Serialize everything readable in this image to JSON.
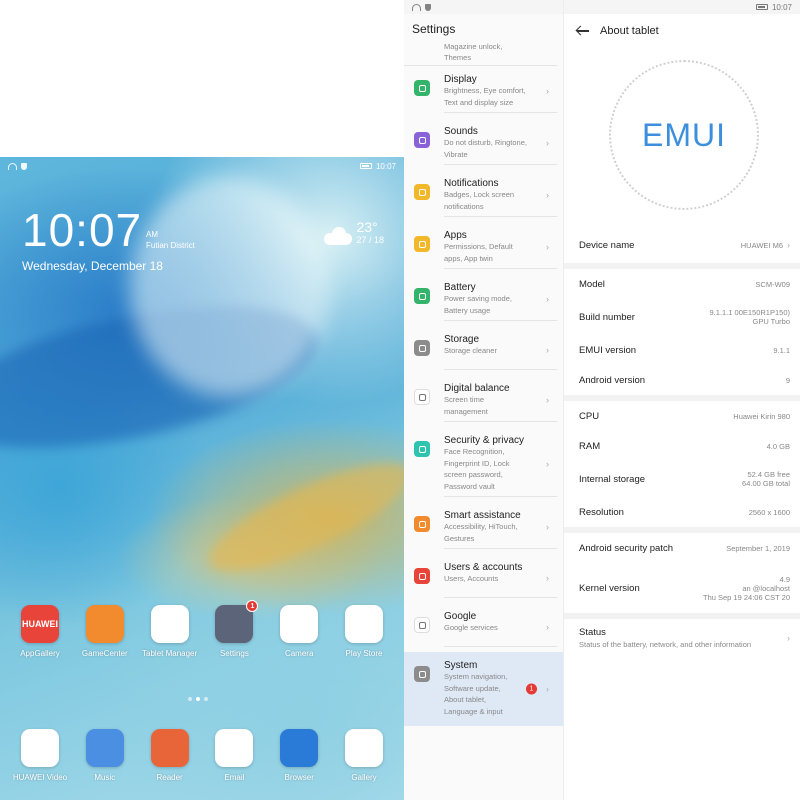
{
  "home": {
    "status_time": "10:07",
    "clock_time": "10:07",
    "ampm": "AM",
    "location": "Futian District",
    "date": "Wednesday, December 18",
    "weather": {
      "temp": "23°",
      "range": "27 / 18"
    },
    "apps_row1": [
      {
        "label": "AppGallery",
        "icon": "appgallery-icon",
        "color": "#e8443a",
        "text": "HUAWEI"
      },
      {
        "label": "GameCenter",
        "icon": "gamecenter-icon",
        "color": "#f28a2e",
        "text": ""
      },
      {
        "label": "Tablet Manager",
        "icon": "tablet-manager-icon",
        "color": "#ffffff",
        "text": ""
      },
      {
        "label": "Settings",
        "icon": "settings-icon",
        "color": "#5b6478",
        "text": "",
        "badge": "1"
      },
      {
        "label": "Camera",
        "icon": "camera-icon",
        "color": "#ffffff",
        "text": ""
      },
      {
        "label": "Play Store",
        "icon": "play-store-icon",
        "color": "#ffffff",
        "text": ""
      }
    ],
    "apps_dock": [
      {
        "label": "HUAWEI Video",
        "icon": "video-icon",
        "color": "#ffffff",
        "text": ""
      },
      {
        "label": "Music",
        "icon": "music-icon",
        "color": "#4b8fe3",
        "text": ""
      },
      {
        "label": "Reader",
        "icon": "reader-icon",
        "color": "#e8653a",
        "text": ""
      },
      {
        "label": "Email",
        "icon": "email-icon",
        "color": "#ffffff",
        "text": ""
      },
      {
        "label": "Browser",
        "icon": "browser-icon",
        "color": "#2a7ad8",
        "text": ""
      },
      {
        "label": "Gallery",
        "icon": "gallery-icon",
        "color": "#ffffff",
        "text": ""
      }
    ]
  },
  "settings": {
    "status_time": "10:07",
    "title": "Settings",
    "partial_top": [
      "Magazine unlock,",
      "Themes"
    ],
    "items": [
      {
        "title": "Display",
        "sub": [
          "Brightness, Eye comfort,",
          "Text and display size"
        ],
        "color": "#33b46a",
        "icon": "display-icon"
      },
      {
        "title": "Sounds",
        "sub": [
          "Do not disturb, Ringtone,",
          "Vibrate"
        ],
        "color": "#8a62d8",
        "icon": "sounds-icon"
      },
      {
        "title": "Notifications",
        "sub": [
          "Badges, Lock screen",
          "notifications"
        ],
        "color": "#f2b829",
        "icon": "notifications-icon"
      },
      {
        "title": "Apps",
        "sub": [
          "Permissions, Default",
          "apps, App twin"
        ],
        "color": "#f2b829",
        "icon": "apps-icon"
      },
      {
        "title": "Battery",
        "sub": [
          "Power saving mode,",
          "Battery usage"
        ],
        "color": "#33b46a",
        "icon": "battery-icon"
      },
      {
        "title": "Storage",
        "sub": [
          "Storage cleaner"
        ],
        "color": "#8c8c8c",
        "icon": "storage-icon"
      },
      {
        "title": "Digital balance",
        "sub": [
          "Screen time",
          "management"
        ],
        "color": "#ffffff",
        "icon": "digital-balance-icon"
      },
      {
        "title": "Security & privacy",
        "sub": [
          "Face Recognition,",
          "Fingerprint ID, Lock",
          "screen password,",
          "Password vault"
        ],
        "color": "#2ec4b0",
        "icon": "security-icon"
      },
      {
        "title": "Smart assistance",
        "sub": [
          "Accessibility, HiTouch,",
          "Gestures"
        ],
        "color": "#f28a2e",
        "icon": "smart-assistance-icon"
      },
      {
        "title": "Users & accounts",
        "sub": [
          "Users, Accounts"
        ],
        "color": "#e8443a",
        "icon": "users-icon"
      },
      {
        "title": "Google",
        "sub": [
          "Google services"
        ],
        "color": "#ffffff",
        "icon": "google-icon"
      },
      {
        "title": "System",
        "sub": [
          "System navigation,",
          "Software update,",
          "About tablet,",
          "Language & input"
        ],
        "color": "#8c8c8c",
        "icon": "system-icon",
        "badge": "1"
      }
    ]
  },
  "about": {
    "status_time": "10:07",
    "title": "About tablet",
    "logo_text": "EMUI",
    "device_name": {
      "label": "Device name",
      "value": "HUAWEI M6"
    },
    "group1": [
      {
        "label": "Model",
        "value": [
          "SCM-W09"
        ]
      },
      {
        "label": "Build number",
        "value": [
          "9.1.1.1 00E150R1P150)",
          "GPU Turbo"
        ]
      },
      {
        "label": "EMUI version",
        "value": [
          "9.1.1"
        ]
      },
      {
        "label": "Android version",
        "value": [
          "9"
        ]
      }
    ],
    "group2": [
      {
        "label": "CPU",
        "value": [
          "Huawei Kirin 980"
        ]
      },
      {
        "label": "RAM",
        "value": [
          "4.0 GB"
        ]
      },
      {
        "label": "Internal storage",
        "value": [
          "52.4  GB free",
          "64.00  GB total"
        ]
      },
      {
        "label": "Resolution",
        "value": [
          "2560 x 1600"
        ]
      }
    ],
    "group3": [
      {
        "label": "Android security patch",
        "value": [
          "September 1, 2019"
        ]
      },
      {
        "label": "Kernel version",
        "value": [
          "4.9",
          "an @localhost",
          "Thu Sep 19 24:06 CST 20"
        ]
      }
    ],
    "status": {
      "title": "Status",
      "sub": "Status of the battery, network, and other information"
    }
  }
}
